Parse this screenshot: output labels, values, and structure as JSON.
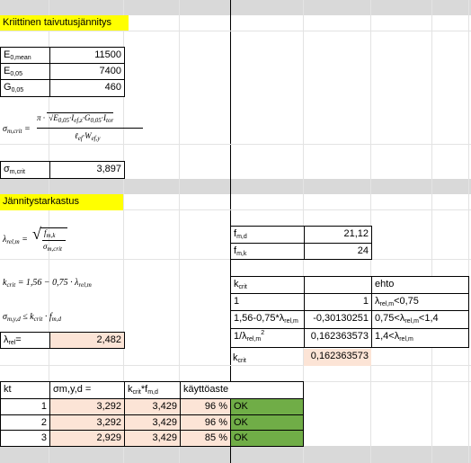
{
  "header1": "Kriittinen taivutusjännitys",
  "header2": "Jännitystarkastus",
  "material": [
    {
      "sym": "E",
      "sub": "0,mean",
      "value": "11500"
    },
    {
      "sym": "E",
      "sub": "0,05",
      "value": "7400"
    },
    {
      "sym": "G",
      "sub": "0,05",
      "value": "460"
    }
  ],
  "formula_sigma_crit": {
    "lhs_sym": "σ",
    "lhs_sub": "m,crit",
    "eq": "=",
    "pi": "π",
    "dot": "·",
    "e_sym": "E",
    "e_sub": "0,05",
    "i_sym": "I",
    "iz_sub": "ef,z",
    "g_sym": "G",
    "g_sub": "0,05",
    "it_sub": "tor",
    "l_sym": "ℓ",
    "l_sub": "ef",
    "w_sym": "W",
    "w_sub": "ef,y"
  },
  "sigma_crit": {
    "sym": "σ",
    "sub": "m,crit",
    "value": "3,897"
  },
  "formula_lambda": {
    "lhs": "λ",
    "lhs_sub": "rel,m",
    "eq": "=",
    "num": "f",
    "num_sub": "m,k",
    "den": "σ",
    "den_sub": "m,crit"
  },
  "formula_kcrit": {
    "k": "k",
    "k_sub": "crit",
    "rhs": "= 1,56 − 0,75 · λ",
    "rhs_sub": "rel,m"
  },
  "formula_cond": {
    "s": "σ",
    "s_sub": "m,y,d",
    "le": "≤ k",
    "k_sub": "crit",
    "f": "· f",
    "f_sub": "m,d"
  },
  "lambda_row": {
    "label": "λ",
    "label_sub": "rel",
    "label_tail": "=",
    "value": "2,482"
  },
  "strength": [
    {
      "sym": "f",
      "sub": "m,d",
      "value": "21,12"
    },
    {
      "sym": "f",
      "sub": "m,k",
      "value": "24"
    }
  ],
  "kcrit_table": {
    "title": "k",
    "title_sub": "crit",
    "ehto": "ehto",
    "rows": [
      {
        "expr": "1",
        "value": "1",
        "cond": "λ",
        "cond_sub": "rel,m",
        "cond_tail": "<0,75"
      },
      {
        "expr": "1,56-0,75*λ",
        "expr_sub": "rel,m",
        "value": "-0,30130251",
        "cond_pre": "0,75<λ",
        "cond_sub": "rel,m",
        "cond_tail": "<1,4"
      },
      {
        "expr": "1/λ",
        "expr_sub": "rel,m",
        "expr_sup": "2",
        "value": "0,162363573",
        "cond_pre": "1,4<λ",
        "cond_sub": "rel,m",
        "cond_tail": ""
      }
    ],
    "result_label": "k",
    "result_sub": "crit",
    "result_value": "0,162363573"
  },
  "check_table": {
    "headers": [
      "kt",
      "σm,y,d =",
      "k",
      "käyttöaste"
    ],
    "h3_sub": "crit",
    "h3_tail": "*f",
    "h3_sub2": "m,d",
    "rows": [
      {
        "kt": "1",
        "sigma": "3,292",
        "kf": "3,429",
        "ratio": "96 %",
        "status": "OK"
      },
      {
        "kt": "2",
        "sigma": "3,292",
        "kf": "3,429",
        "ratio": "96 %",
        "status": "OK"
      },
      {
        "kt": "3",
        "sigma": "2,929",
        "kf": "3,429",
        "ratio": "85 %",
        "status": "OK"
      }
    ]
  }
}
